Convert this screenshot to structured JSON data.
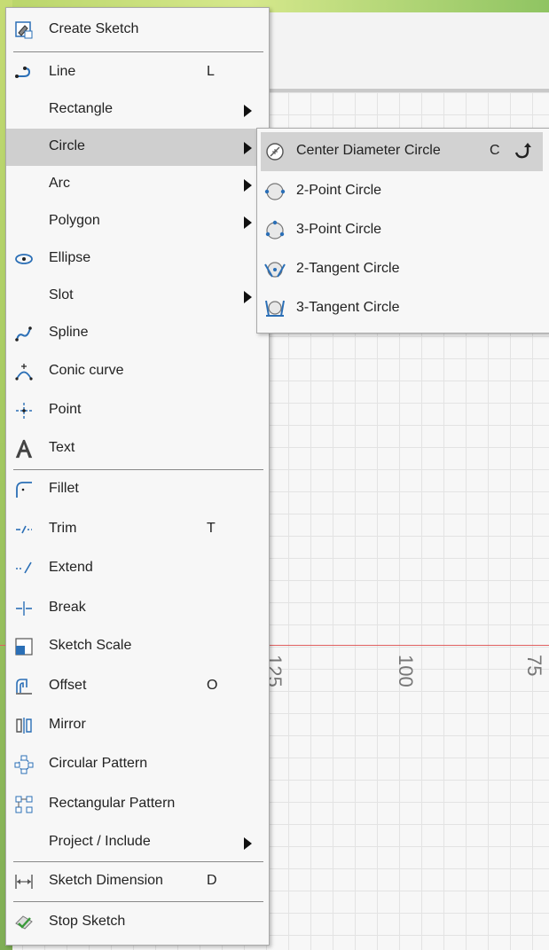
{
  "menu": {
    "items": [
      {
        "label": "Create Sketch",
        "icon": "create-sketch-icon"
      },
      {
        "label": "Line",
        "shortcut": "L",
        "icon": "line-icon"
      },
      {
        "label": "Rectangle",
        "submenu": true
      },
      {
        "label": "Circle",
        "submenu": true,
        "highlighted": true
      },
      {
        "label": "Arc",
        "submenu": true
      },
      {
        "label": "Polygon",
        "submenu": true
      },
      {
        "label": "Ellipse",
        "icon": "ellipse-icon"
      },
      {
        "label": "Slot",
        "submenu": true
      },
      {
        "label": "Spline",
        "icon": "spline-icon"
      },
      {
        "label": "Conic curve",
        "icon": "conic-curve-icon"
      },
      {
        "label": "Point",
        "icon": "point-icon"
      },
      {
        "label": "Text",
        "icon": "text-icon"
      },
      {
        "label": "Fillet",
        "icon": "fillet-icon"
      },
      {
        "label": "Trim",
        "shortcut": "T",
        "icon": "trim-icon"
      },
      {
        "label": "Extend",
        "icon": "extend-icon"
      },
      {
        "label": "Break",
        "icon": "break-icon"
      },
      {
        "label": "Sketch Scale",
        "icon": "sketch-scale-icon"
      },
      {
        "label": "Offset",
        "shortcut": "O",
        "icon": "offset-icon"
      },
      {
        "label": "Mirror",
        "icon": "mirror-icon"
      },
      {
        "label": "Circular Pattern",
        "icon": "circular-pattern-icon"
      },
      {
        "label": "Rectangular Pattern",
        "icon": "rectangular-pattern-icon"
      },
      {
        "label": "Project / Include",
        "submenu": true
      },
      {
        "label": "Sketch Dimension",
        "shortcut": "D",
        "icon": "sketch-dimension-icon"
      },
      {
        "label": "Stop Sketch",
        "icon": "stop-sketch-icon"
      }
    ]
  },
  "submenu": {
    "items": [
      {
        "label": "Center Diameter Circle",
        "shortcut": "C",
        "highlighted": true,
        "icon": "center-diameter-circle-icon"
      },
      {
        "label": "2-Point Circle",
        "icon": "two-point-circle-icon"
      },
      {
        "label": "3-Point Circle",
        "icon": "three-point-circle-icon"
      },
      {
        "label": "2-Tangent Circle",
        "icon": "two-tangent-circle-icon"
      },
      {
        "label": "3-Tangent Circle",
        "icon": "three-tangent-circle-icon"
      }
    ]
  },
  "canvas": {
    "ruler_labels": [
      "125",
      "100",
      "75"
    ]
  },
  "colors": {
    "highlight": "#cfcfcf",
    "icon_blue": "#2b6fb6",
    "axis_red": "#e06060"
  }
}
